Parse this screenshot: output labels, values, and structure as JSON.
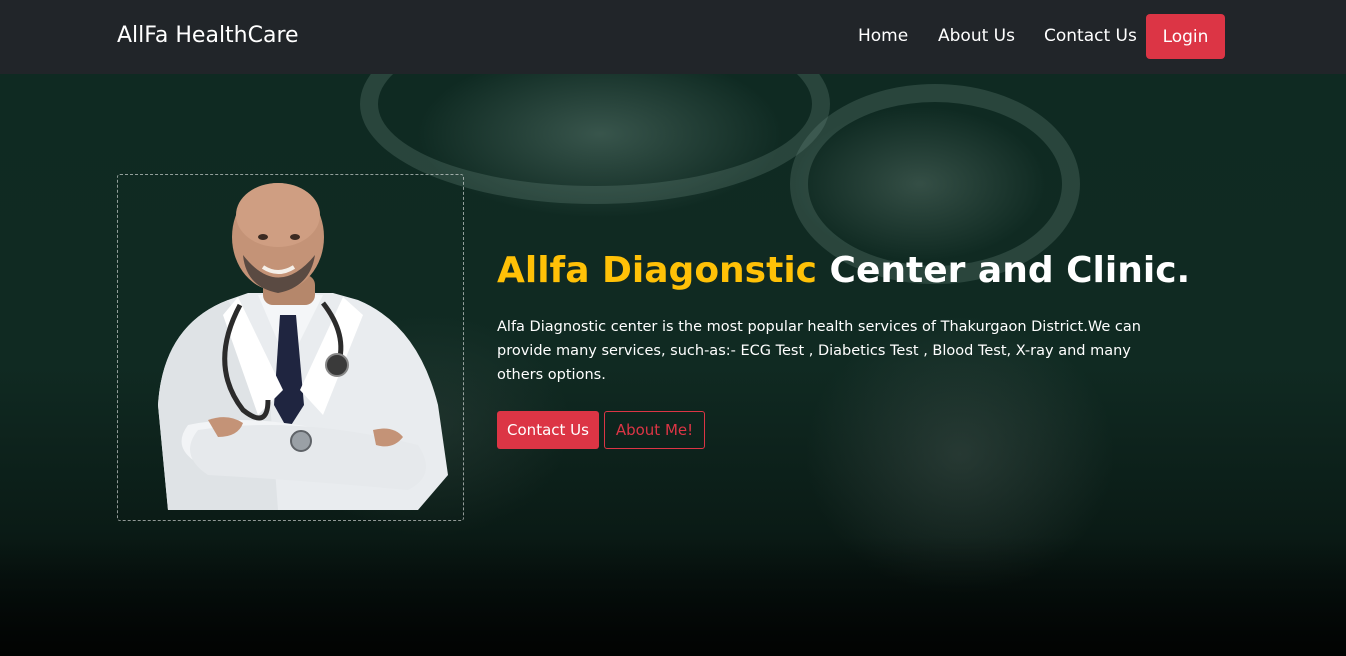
{
  "navbar": {
    "brand": "AllFa HealthCare",
    "links": [
      "Home",
      "About Us",
      "Contact Us"
    ],
    "login_label": "Login"
  },
  "hero": {
    "headline_highlight": "Allfa Diagonstic",
    "headline_rest": " Center and Clinic.",
    "description": "Alfa Diagnostic center is the most popular health services of Thakurgaon District.We can provide many services, such-as:- ECG Test , Diabetics Test , Blood Test, X-ray and many others options.",
    "contact_button": "Contact Us",
    "about_button": "About Me!"
  },
  "colors": {
    "navbar_bg": "#212529",
    "accent_red": "#dc3545",
    "highlight_yellow": "#ffc107"
  }
}
